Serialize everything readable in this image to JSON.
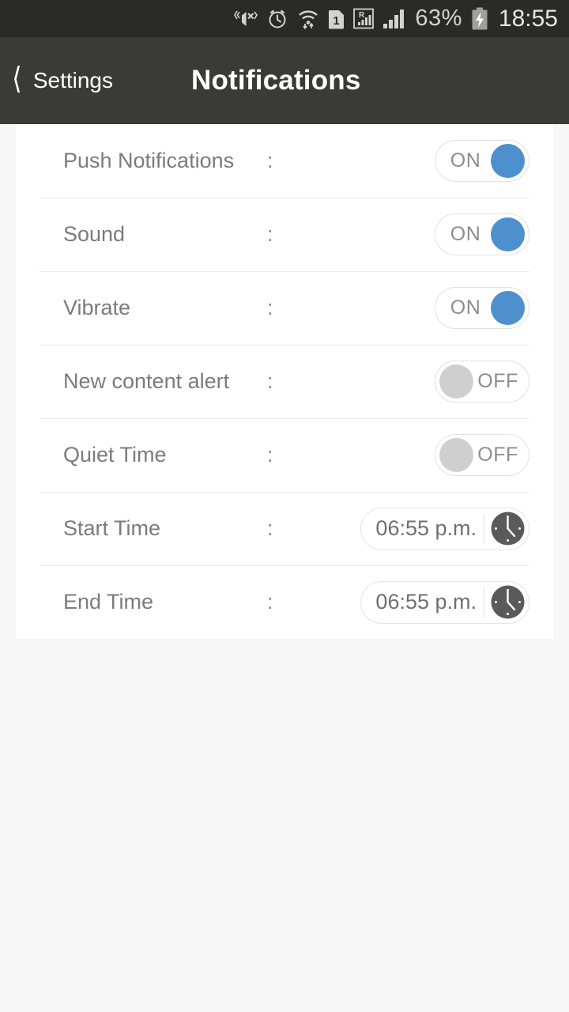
{
  "statusbar": {
    "icons": [
      "vibrate-mute-icon",
      "alarm-clock-icon",
      "wifi-transfer-icon",
      "sim-1-icon",
      "roaming-signal-icon",
      "signal-bars-icon"
    ],
    "battery_percent": "63%",
    "battery_icon": "battery-charging-icon",
    "time": "18:55"
  },
  "header": {
    "back_icon": "back-chevron-icon",
    "back_label": "Settings",
    "title": "Notifications"
  },
  "settings": {
    "separator": ":",
    "rows": [
      {
        "label": "Push Notifications",
        "control": "toggle",
        "state": "ON",
        "on": true
      },
      {
        "label": "Sound",
        "control": "toggle",
        "state": "ON",
        "on": true
      },
      {
        "label": "Vibrate",
        "control": "toggle",
        "state": "ON",
        "on": true
      },
      {
        "label": "New content alert",
        "control": "toggle",
        "state": "OFF",
        "on": false
      },
      {
        "label": "Quiet Time",
        "control": "toggle",
        "state": "OFF",
        "on": false
      },
      {
        "label": "Start Time",
        "control": "time",
        "value": "06:55 p.m.",
        "icon": "clock-icon"
      },
      {
        "label": "End Time",
        "control": "time",
        "value": "06:55 p.m.",
        "icon": "clock-icon"
      }
    ]
  },
  "colors": {
    "toggle_on_accent": "#4d90cd",
    "toggle_off_knob": "#cfcfcf",
    "header_bg": "#3a3b38",
    "statusbar_bg": "#2a2b29",
    "card_bg": "#ffffff",
    "page_bg": "#f7f7f7",
    "label_text": "#7b7b7b"
  }
}
